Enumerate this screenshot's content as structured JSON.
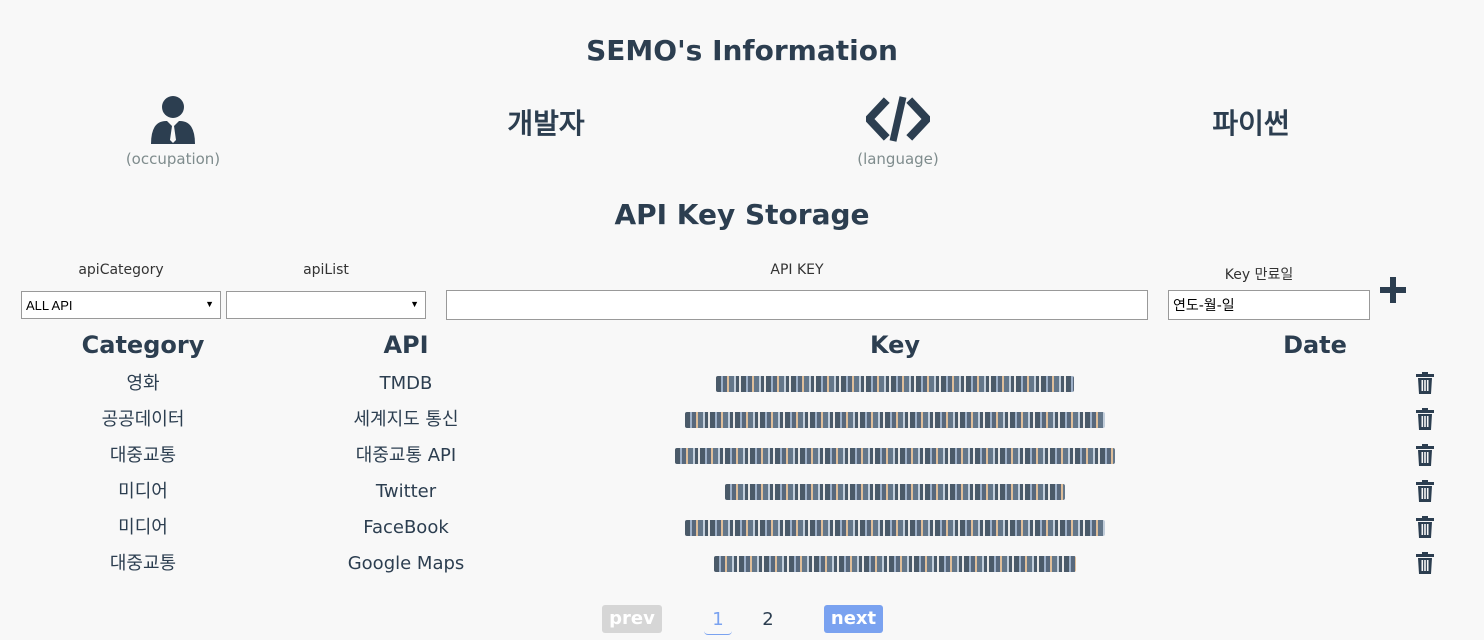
{
  "header": {
    "title": "SEMO's Information"
  },
  "info": {
    "occupation": {
      "icon": "user-tie-icon",
      "caption": "(occupation)",
      "value": "개발자"
    },
    "language": {
      "icon": "code-icon",
      "caption": "(language)",
      "value": "파이썬"
    }
  },
  "storage": {
    "title": "API Key Storage"
  },
  "form": {
    "category_label": "apiCategory",
    "category_value": "ALL API",
    "list_label": "apiList",
    "list_value": "",
    "key_label": "API KEY",
    "key_value": "",
    "expire_label": "Key 만료일",
    "expire_placeholder": "연도-월-일",
    "add_icon": "plus-icon"
  },
  "table": {
    "headers": {
      "category": "Category",
      "api": "API",
      "key": "Key",
      "date": "Date"
    },
    "rows": [
      {
        "category": "영화",
        "api": "TMDB",
        "key": "[blurred]",
        "date": ""
      },
      {
        "category": "공공데이터",
        "api": "세계지도 통신",
        "key": "[blurred]",
        "date": ""
      },
      {
        "category": "대중교통",
        "api": "대중교통 API",
        "key": "[blurred]",
        "date": ""
      },
      {
        "category": "미디어",
        "api": "Twitter",
        "key": "[blurred]",
        "date": ""
      },
      {
        "category": "미디어",
        "api": "FaceBook",
        "key": "[blurred]",
        "date": ""
      },
      {
        "category": "대중교통",
        "api": "Google Maps",
        "key": "[blurred]",
        "date": ""
      }
    ],
    "delete_icon": "trash-icon"
  },
  "pagination": {
    "prev": "prev",
    "pages": [
      "1",
      "2"
    ],
    "current": "1",
    "next": "next"
  },
  "colors": {
    "text": "#2c3e50",
    "prev_disabled": "#d6d6d6",
    "next_active": "#7aa2f0",
    "page_underline": "#7aa2f0"
  }
}
